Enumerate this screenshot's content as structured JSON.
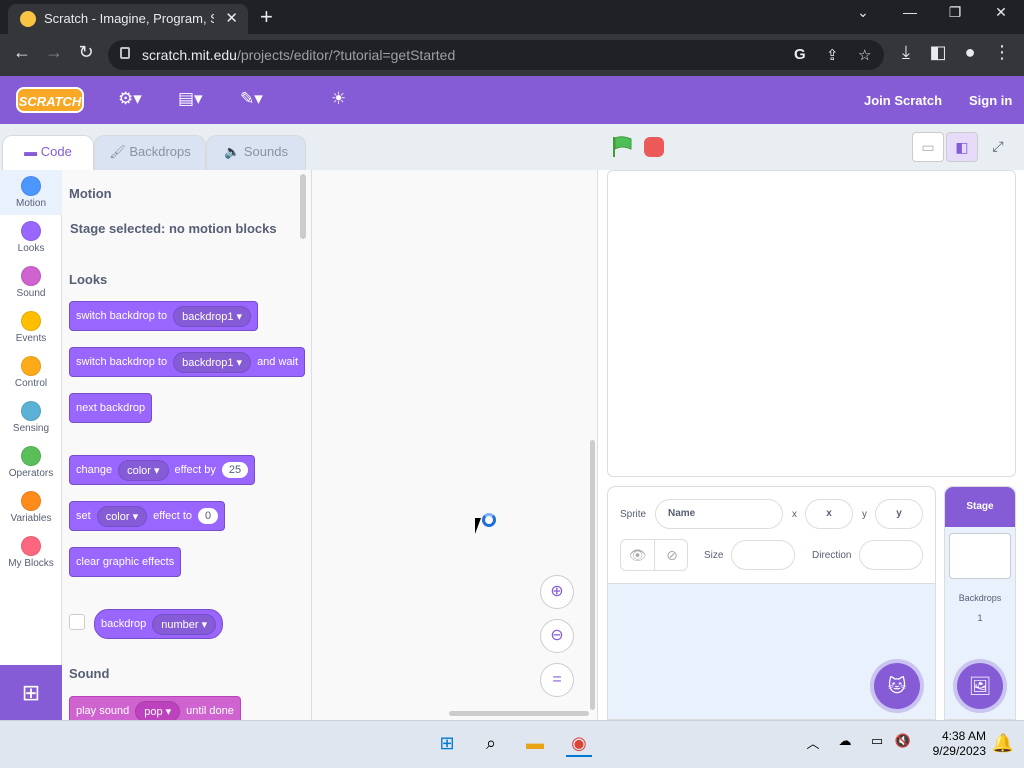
{
  "browser": {
    "tab_title": "Scratch - Imagine, Program, Shar",
    "tab_close": "✕",
    "new_tab": "+",
    "url_host": "scratch.mit.edu",
    "url_path": "/projects/editor/?tutorial=getStarted",
    "window_buttons": {
      "minimize": "—",
      "restore": "❐",
      "close": "✕",
      "tabs_dropdown": "⌄"
    }
  },
  "menubar": {
    "logo_text": "SCRATCH",
    "join": "Join Scratch",
    "signin": "Sign in",
    "color": "#855cd6"
  },
  "editor_tabs": [
    {
      "label": "Code",
      "active": true
    },
    {
      "label": "Backdrops",
      "active": false
    },
    {
      "label": "Sounds",
      "active": false
    }
  ],
  "categories": [
    {
      "label": "Motion",
      "color": "#4c97ff"
    },
    {
      "label": "Looks",
      "color": "#9966ff"
    },
    {
      "label": "Sound",
      "color": "#cf63cf"
    },
    {
      "label": "Events",
      "color": "#ffbf00"
    },
    {
      "label": "Control",
      "color": "#ffab19"
    },
    {
      "label": "Sensing",
      "color": "#5cb1d6"
    },
    {
      "label": "Operators",
      "color": "#59c059"
    },
    {
      "label": "Variables",
      "color": "#ff8c1a"
    },
    {
      "label": "My Blocks",
      "color": "#ff6680"
    }
  ],
  "palette": {
    "motion_title": "Motion",
    "motion_note": "Stage selected: no motion blocks",
    "looks_title": "Looks",
    "sound_title": "Sound",
    "blocks": {
      "switch_backdrop": {
        "text": "switch backdrop to",
        "value": "backdrop1"
      },
      "switch_backdrop_wait": {
        "text": "switch backdrop to",
        "value": "backdrop1",
        "suffix": "and wait"
      },
      "next_backdrop": {
        "text": "next backdrop"
      },
      "change_effect": {
        "text": "change",
        "menu": "color",
        "mid": "effect by",
        "num": "25"
      },
      "set_effect": {
        "text": "set",
        "menu": "color",
        "mid": "effect to",
        "num": "0"
      },
      "clear_effects": {
        "text": "clear graphic effects"
      },
      "backdrop_reporter": {
        "text": "backdrop",
        "menu": "number"
      },
      "play_sound": {
        "text": "play sound",
        "menu": "pop",
        "suffix": "until done"
      }
    }
  },
  "sprite_info": {
    "sprite_label": "Sprite",
    "name_placeholder": "Name",
    "x_label": "x",
    "x_placeholder": "x",
    "y_label": "y",
    "y_placeholder": "y",
    "size_label": "Size",
    "direction_label": "Direction"
  },
  "stage_pane": {
    "title": "Stage",
    "backdrops_label": "Backdrops",
    "backdrops_count": "1"
  },
  "taskbar": {
    "time": "4:38 AM",
    "date": "9/29/2023"
  }
}
